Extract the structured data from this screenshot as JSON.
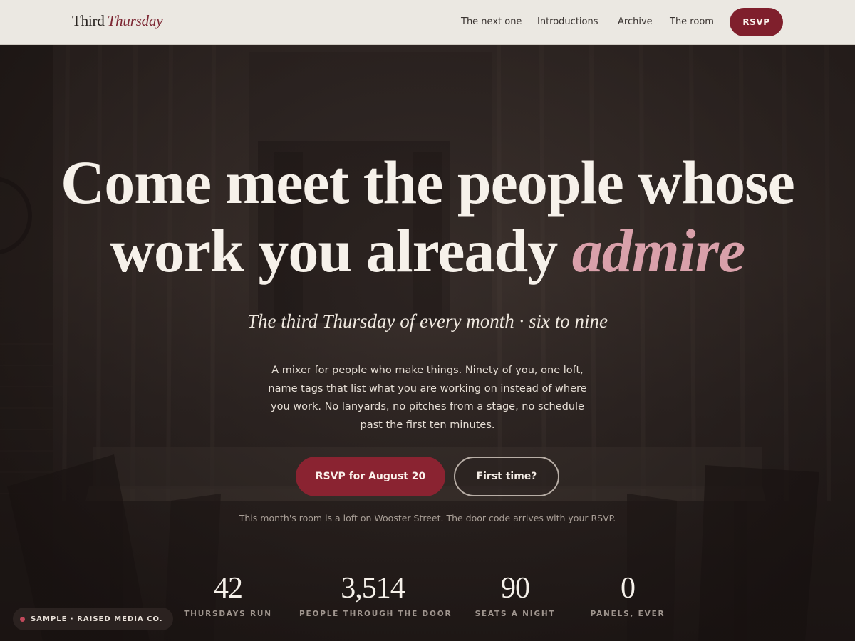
{
  "brand": {
    "name": "Third",
    "accent": "Thursday"
  },
  "nav": {
    "links": [
      {
        "label": "The next one"
      },
      {
        "label": "Introductions"
      },
      {
        "label": "Archive"
      },
      {
        "label": "The room"
      }
    ],
    "rsvp_label": "RSVP"
  },
  "hero": {
    "headline_line1": "Come meet the people whose",
    "headline_line2_start": "work you already",
    "headline_accent": "admire",
    "subhead": "The third Thursday of every month · six to nine",
    "body": "A mixer for people who make things. Ninety of you, one loft, name tags that list what you are working on instead of where you work. No lanyards, no pitches from a stage, no schedule past the first ten minutes.",
    "primary_cta": "RSVP for August 20",
    "secondary_cta": "First time?",
    "note": "This month's room is a loft on Wooster Street. The door code arrives with your RSVP."
  },
  "stats": [
    {
      "value": "42",
      "label": "THURSDAYS RUN"
    },
    {
      "value": "3,514",
      "label": "PEOPLE THROUGH THE DOOR"
    },
    {
      "value": "90",
      "label": "SEATS A NIGHT"
    },
    {
      "value": "0",
      "label": "PANELS, EVER"
    }
  ],
  "badge": {
    "text": "SAMPLE · RAISED MEDIA CO."
  },
  "colors": {
    "accent": "#7f1f2c",
    "accent_pink": "#d9a0aa",
    "nav_background": "#ebe8e2",
    "hero_background": "#2e2624"
  }
}
